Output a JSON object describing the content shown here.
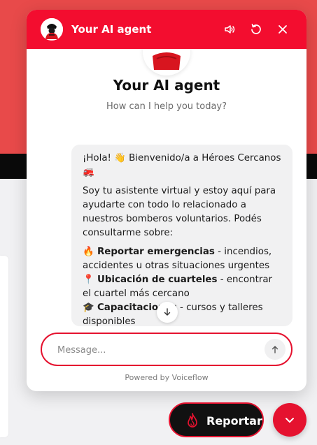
{
  "widget": {
    "header": {
      "title": "Your AI agent"
    },
    "intro": {
      "title": "Your AI agent",
      "subtitle": "How can I help you today?"
    },
    "message": {
      "greeting": "¡Hola! 👋 Bienvenido/a a Héroes Cercanos 🚒",
      "intro": "Soy tu asistente virtual y estoy aquí para ayudarte con todo lo relacionado a nuestros bomberos voluntarios. Podés consultarme sobre:",
      "items": [
        {
          "emoji": "🔥",
          "bold": "Reportar emergencias",
          "text": " - incendios, accidentes u otras situaciones urgentes"
        },
        {
          "emoji": "📍",
          "bold": "Ubicación de cuarteles",
          "text": " - encontrar el cuartel más cercano"
        },
        {
          "emoji": "🎓",
          "bold": "Capacitaciones",
          "text": " - cursos y talleres disponibles"
        }
      ]
    },
    "composer": {
      "placeholder": "Message..."
    },
    "footer": "Powered by Voiceflow"
  },
  "floating": {
    "report_label": "Reportar"
  },
  "colors": {
    "brand_red": "#f30d2f",
    "accent_red": "#e5122f",
    "dark": "#111111"
  },
  "icons": [
    "agent-avatar-icon",
    "volume-icon",
    "restart-icon",
    "close-icon",
    "arrow-down-icon",
    "send-arrow-icon",
    "fire-icon",
    "chevron-down-icon"
  ]
}
